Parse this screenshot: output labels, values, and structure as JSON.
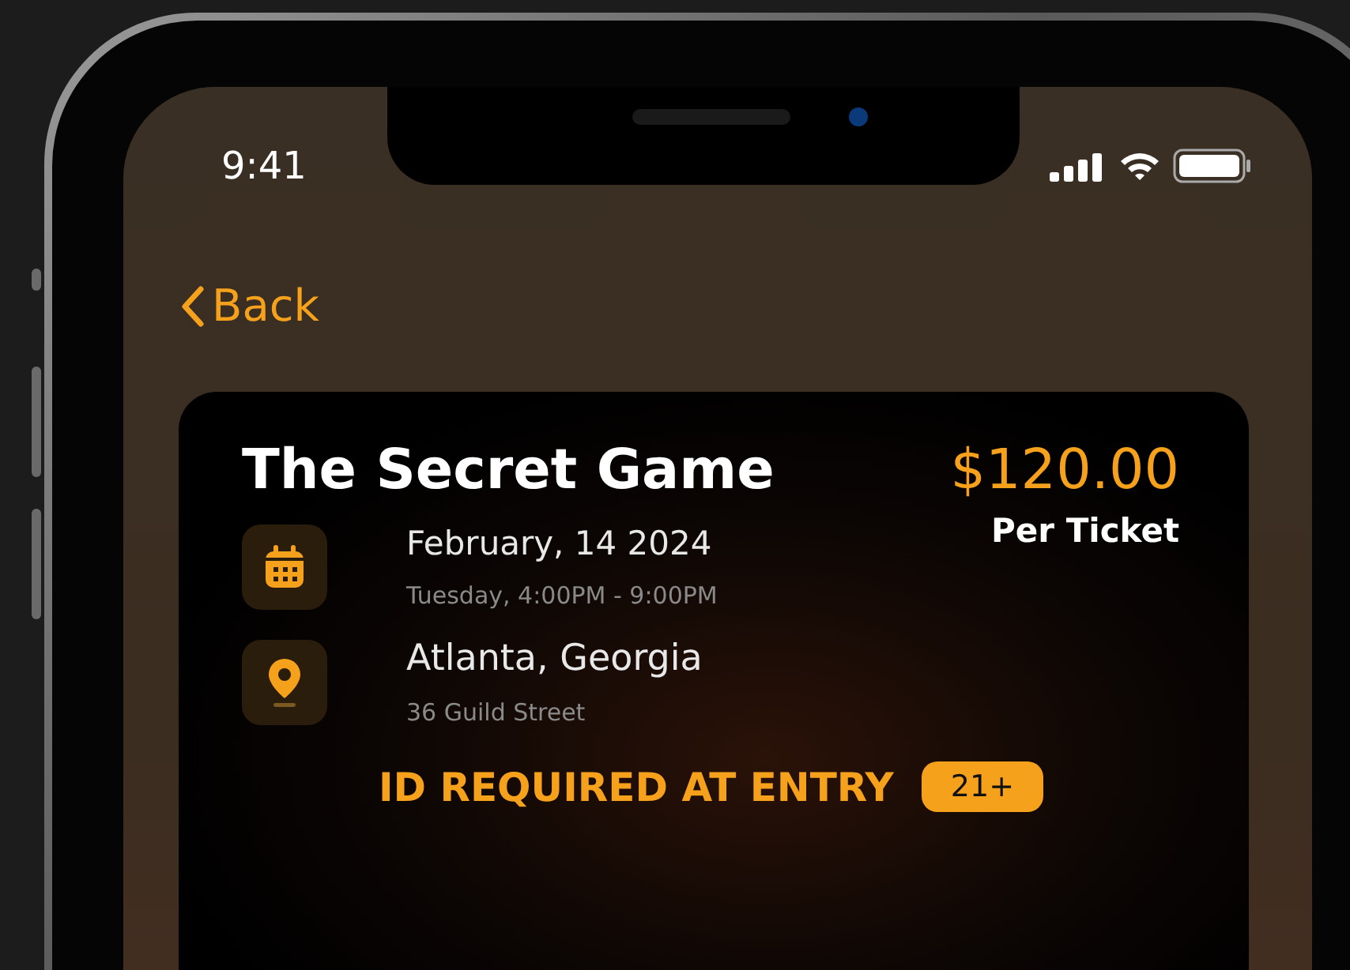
{
  "status_bar": {
    "time": "9:41"
  },
  "nav": {
    "back_label": "Back"
  },
  "event": {
    "title": "The Secret Game",
    "price": "$120.00",
    "price_caption": "Per Ticket",
    "details": [
      {
        "kind": "date",
        "primary": "February, 14 2024",
        "secondary": "Tuesday, 4:00PM - 9:00PM"
      },
      {
        "kind": "location",
        "primary": "Atlanta, Georgia",
        "secondary": "36 Guild Street"
      }
    ],
    "notice": "ID REQUIRED AT ENTRY",
    "age_badge": "21+"
  }
}
